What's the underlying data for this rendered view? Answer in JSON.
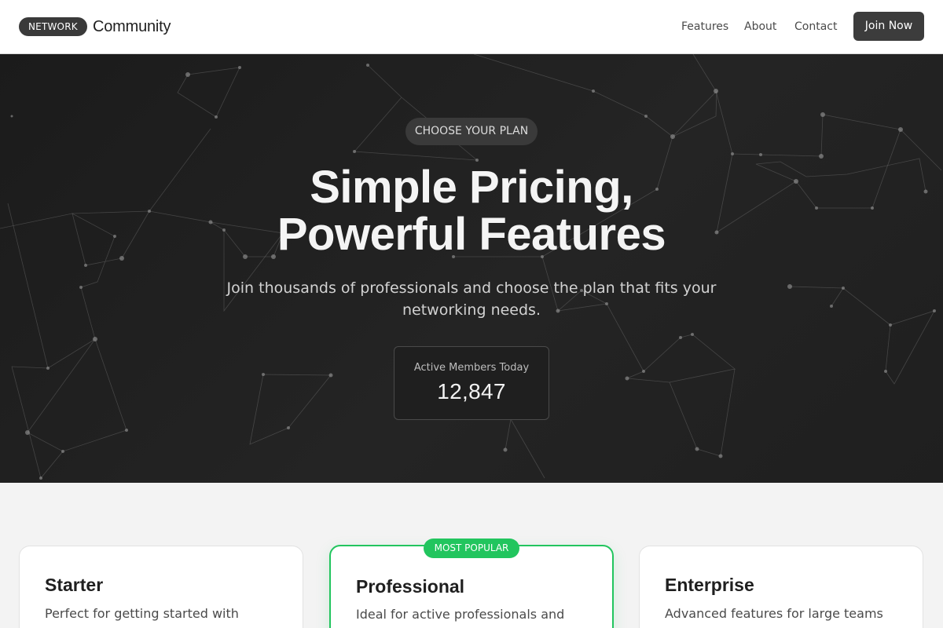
{
  "header": {
    "brand_badge": "NETWORK",
    "brand_name": "Community",
    "nav": {
      "features": "Features",
      "about": "About",
      "contact": "Contact"
    },
    "cta": "Join Now"
  },
  "hero": {
    "tag": "CHOOSE YOUR PLAN",
    "title_line1": "Simple Pricing,",
    "title_line2": "Powerful Features",
    "subtitle": "Join thousands of professionals and choose the plan that fits your networking needs.",
    "stat_label": "Active Members Today",
    "stat_value": "12,847"
  },
  "plans": [
    {
      "name": "Starter",
      "description": "Perfect for getting started with professional networking"
    },
    {
      "name": "Professional",
      "description": "Ideal for active professionals and creators",
      "badge": "MOST POPULAR"
    },
    {
      "name": "Enterprise",
      "description": "Advanced features for large teams and organizations"
    }
  ],
  "colors": {
    "accent": "#22c55e",
    "hero_background": "#202020",
    "dark_button": "#3c3c3c"
  }
}
